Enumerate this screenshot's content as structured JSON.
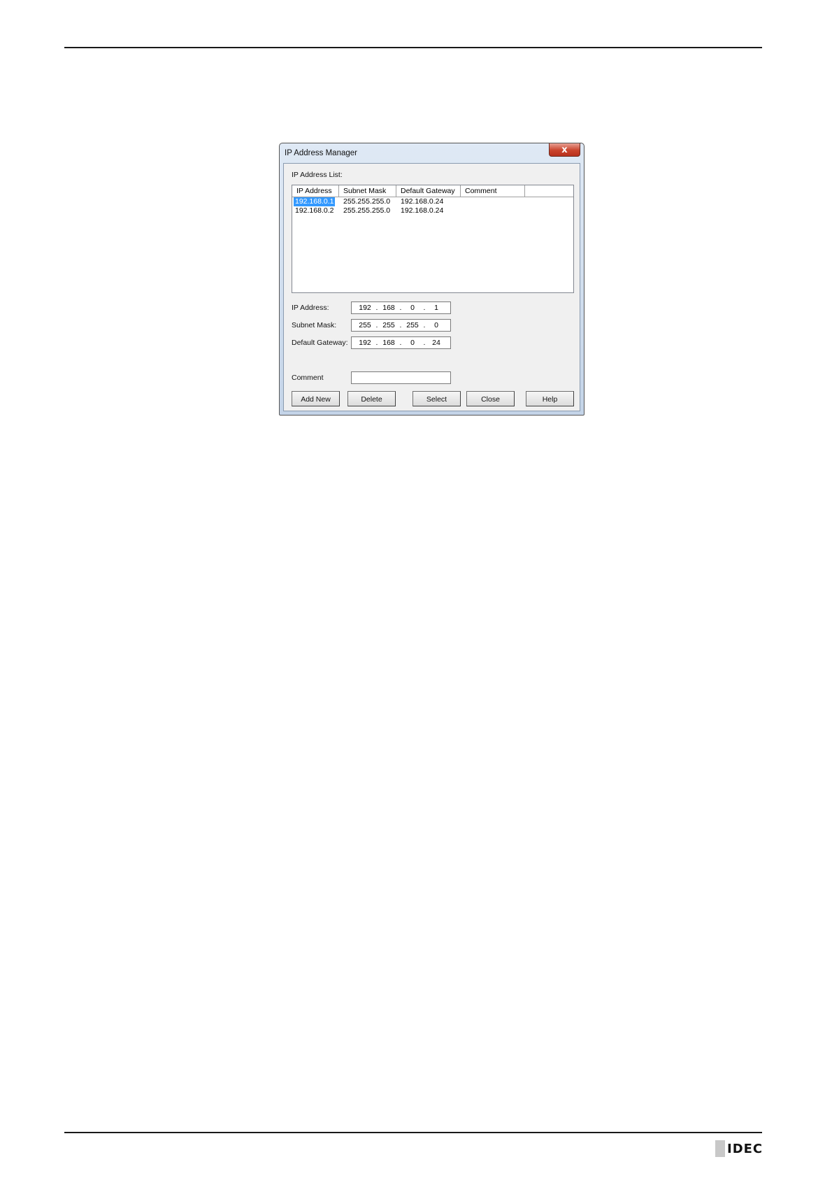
{
  "dialog": {
    "title": "IP Address Manager",
    "close_label": "x",
    "list_label": "IP Address List:",
    "columns": [
      "IP Address",
      "Subnet Mask",
      "Default Gateway",
      "Comment"
    ],
    "rows": [
      {
        "ip": "192.168.0.1",
        "mask": "255.255.255.0",
        "gateway": "192.168.0.24",
        "comment": "",
        "selected": true
      },
      {
        "ip": "192.168.0.2",
        "mask": "255.255.255.0",
        "gateway": "192.168.0.24",
        "comment": "",
        "selected": false
      }
    ],
    "ip_label": "IP Address:",
    "ip_octets": [
      "192",
      "168",
      "0",
      "1"
    ],
    "mask_label": "Subnet Mask:",
    "mask_octets": [
      "255",
      "255",
      "255",
      "0"
    ],
    "gateway_label": "Default Gateway:",
    "gateway_octets": [
      "192",
      "168",
      "0",
      "24"
    ],
    "comment_label": "Comment",
    "comment_value": "",
    "buttons": {
      "add_new": "Add New",
      "delete": "Delete",
      "select": "Select",
      "close": "Close",
      "help": "Help"
    }
  },
  "logo": {
    "text": "IDEC"
  }
}
